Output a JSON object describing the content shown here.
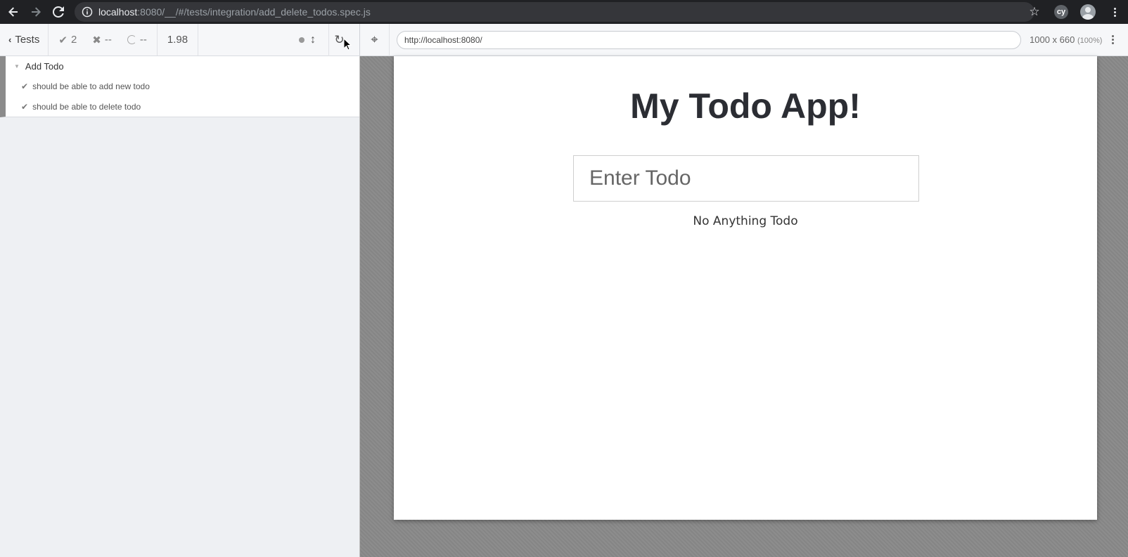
{
  "browser": {
    "url_host": "localhost",
    "url_rest": ":8080/__/#/tests/integration/add_delete_todos.spec.js",
    "extension_badge": "cy"
  },
  "reporter": {
    "tests_label": "Tests",
    "passed_count": "2",
    "failed_count": "--",
    "pending_count": "--",
    "duration": "1.98",
    "suite": {
      "title": "Add Todo",
      "tests": [
        {
          "label": "should be able to add new todo",
          "state": "passed"
        },
        {
          "label": "should be able to delete todo",
          "state": "passed"
        }
      ]
    }
  },
  "aut": {
    "url": "http://localhost:8080/",
    "viewport": "1000 x 660",
    "scale": "(100%)"
  },
  "app": {
    "title": "My Todo App!",
    "input_placeholder": "Enter Todo",
    "empty_message": "No Anything Todo"
  },
  "colors": {
    "chrome_bar": "#202124",
    "omnibox": "#35363a",
    "suite_border": "#8b8b8b",
    "title_text": "#2b2d33"
  }
}
